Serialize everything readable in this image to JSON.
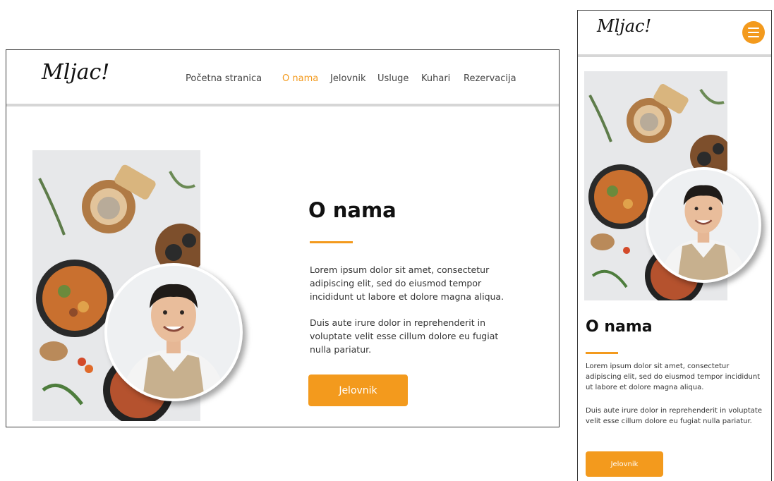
{
  "desktop": {
    "logo": "Mljac!",
    "nav": [
      {
        "label": "Početna stranica"
      },
      {
        "label": "O nama"
      },
      {
        "label": "Jelovnik"
      },
      {
        "label": "Usluge"
      },
      {
        "label": "Kuhari"
      },
      {
        "label": "Rezervacija"
      }
    ],
    "active_nav": "O nama",
    "section": {
      "title": "O nama",
      "p1": "Lorem ipsum dolor sit amet, consectetur adipiscing elit, sed do eiusmod tempor incididunt ut labore et dolore magna aliqua.",
      "p2": "Duis aute irure dolor in reprehenderit in voluptate velit esse cillum dolore eu fugiat nulla pariatur.",
      "button": "Jelovnik"
    }
  },
  "mobile": {
    "logo": "Mljac!",
    "menu_icon": "hamburger-menu-icon",
    "section": {
      "title": "O nama",
      "p1": "Lorem ipsum dolor sit amet, consectetur adipiscing elit, sed do eiusmod tempor incididunt ut labore et dolore magna aliqua.",
      "p2": "Duis aute irure dolor in reprehenderit in voluptate velit esse cillum dolore eu fugiat nulla pariatur.",
      "button": "Jelovnik"
    }
  },
  "colors": {
    "accent": "#f39a1d",
    "text": "#111111",
    "divider": "#d6d6d6"
  }
}
